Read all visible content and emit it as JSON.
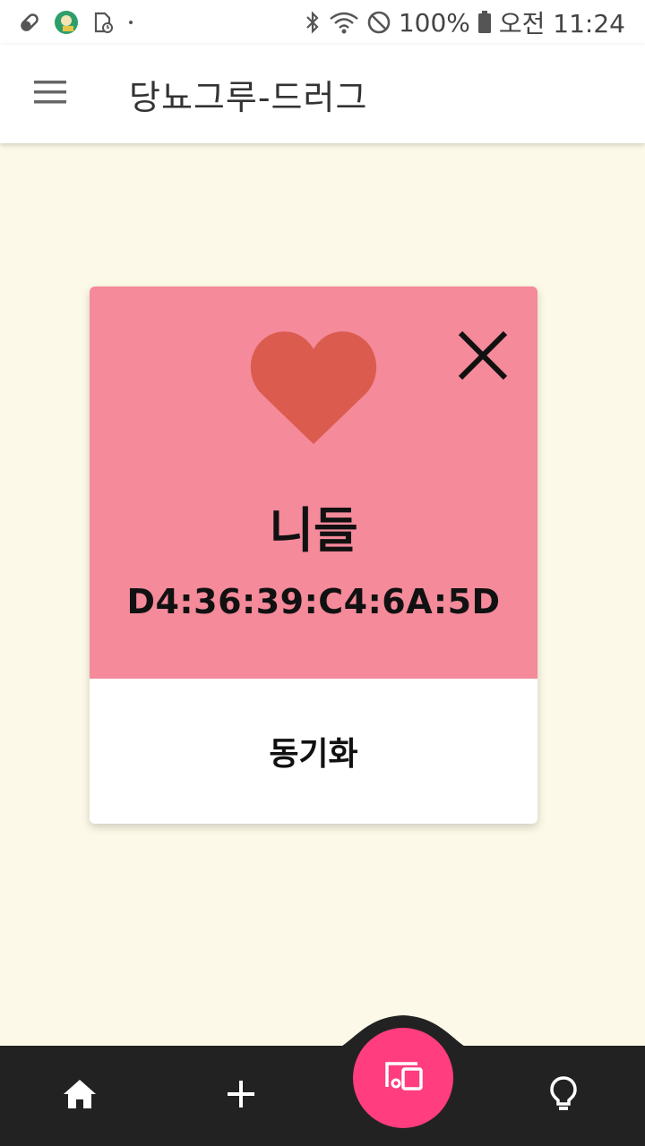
{
  "status_bar": {
    "battery": "100%",
    "time": "오전 11:24",
    "icons": [
      "pill-icon",
      "app-avatar-icon",
      "sim-clock-icon",
      "dot-icon",
      "bluetooth-icon",
      "wifi-icon",
      "do-not-disturb-icon",
      "battery-icon"
    ]
  },
  "app_bar": {
    "title": "당뇨그루-드러그",
    "menu_icon": "hamburger-menu-icon"
  },
  "device_card": {
    "name": "니들",
    "mac": "D4:36:39:C4:6A:5D",
    "sync_label": "동기화",
    "accent_color": "#F48A9A",
    "heart_color": "#DB5C4F",
    "icons": [
      "heart-icon",
      "close-icon"
    ]
  },
  "bottom_nav": {
    "items": [
      "home-icon",
      "plus-icon",
      "devices-icon",
      "lightbulb-icon"
    ],
    "active": "devices-icon",
    "fab_color": "#FF3D7F"
  }
}
